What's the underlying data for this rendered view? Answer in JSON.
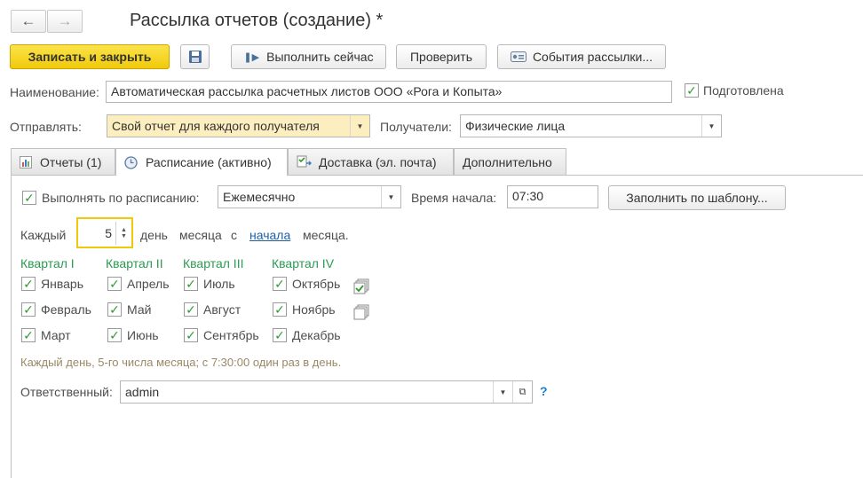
{
  "window": {
    "title": "Рассылка отчетов (создание) *"
  },
  "toolbar": {
    "save_close": "Записать и закрыть",
    "run_now": "Выполнить сейчас",
    "check": "Проверить",
    "events": "События рассылки..."
  },
  "form": {
    "name_label": "Наименование:",
    "name_value": "Автоматическая рассылка расчетных листов ООО «Рога и Копыта»",
    "prepared_label": "Подготовлена",
    "send_label": "Отправлять:",
    "send_value": "Свой отчет для каждого получателя",
    "recipients_label": "Получатели:",
    "recipients_value": "Физические лица"
  },
  "tabs": [
    {
      "label": "Отчеты (1)"
    },
    {
      "label": "Расписание (активно)"
    },
    {
      "label": "Доставка (эл. почта)"
    },
    {
      "label": "Дополнительно"
    }
  ],
  "schedule": {
    "run_label": "Выполнять по расписанию:",
    "period_value": "Ежемесячно",
    "start_label": "Время начала:",
    "start_value": "07:30",
    "fill_button": "Заполнить по шаблону...",
    "each_label": "Каждый",
    "day_value": "5",
    "day_text": "день",
    "month_text": "месяца",
    "from_text": "с",
    "start_link": "начала",
    "month_text2": "месяца.",
    "quarters": [
      {
        "title": "Квартал I",
        "months": [
          "Январь",
          "Февраль",
          "Март"
        ]
      },
      {
        "title": "Квартал II",
        "months": [
          "Апрель",
          "Май",
          "Июнь"
        ]
      },
      {
        "title": "Квартал III",
        "months": [
          "Июль",
          "Август",
          "Сентябрь"
        ]
      },
      {
        "title": "Квартал IV",
        "months": [
          "Октябрь",
          "Ноябрь",
          "Декабрь"
        ]
      }
    ],
    "summary": "Каждый день, 5-го числа месяца; с 7:30:00 один раз в день.",
    "responsible_label": "Ответственный:",
    "responsible_value": "admin",
    "help": "?"
  },
  "colors": {
    "accent_yellow": "#f0c90a",
    "check_green": "#2f9a2f",
    "quarter_green": "#2c9a52",
    "link_blue": "#1f5fa8"
  }
}
